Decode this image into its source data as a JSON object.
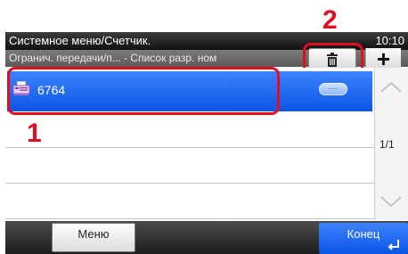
{
  "header": {
    "title": "Системное меню/Счетчик.",
    "clock": "10:10",
    "breadcrumb": "Огранич. передачи/п... - Список разр. ном"
  },
  "toolbar": {
    "delete_icon": "trash-icon",
    "add_label": "+"
  },
  "list": {
    "items": [
      {
        "icon": "fax-icon",
        "label": "6764",
        "detail_label": "···"
      }
    ]
  },
  "pagination": {
    "indicator": "1/1"
  },
  "footer": {
    "menu_label": "Меню",
    "end_label": "Конец"
  },
  "callouts": {
    "first": "1",
    "second": "2"
  },
  "colors": {
    "accent": "#0b55e6",
    "callout": "#e00f20"
  }
}
